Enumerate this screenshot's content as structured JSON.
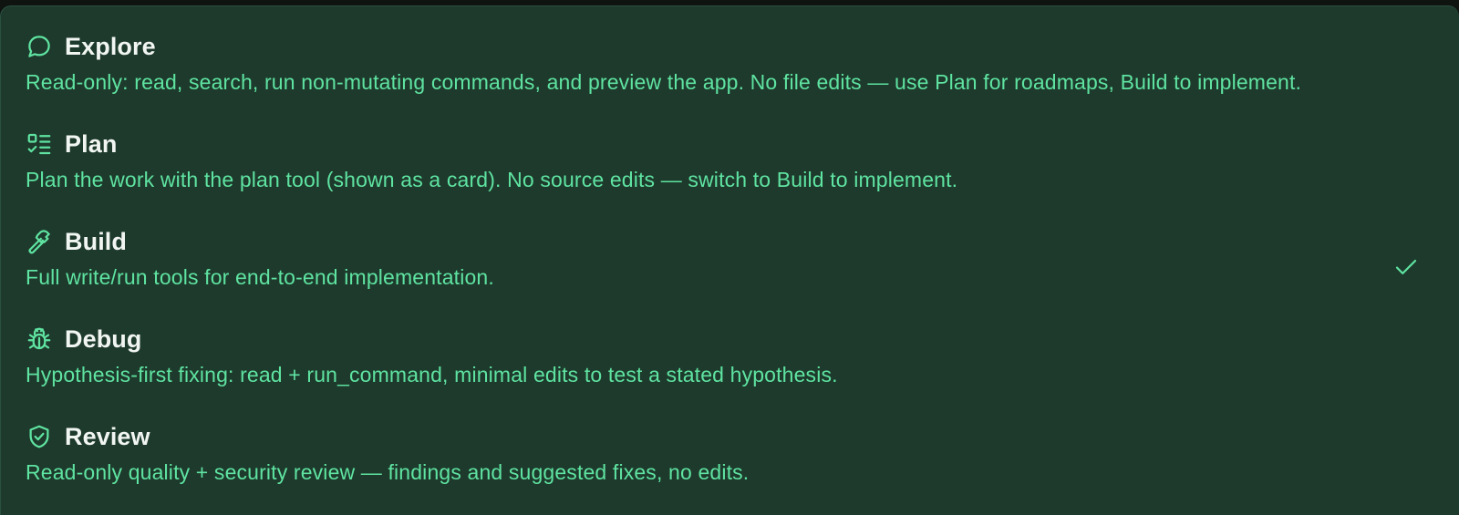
{
  "mode_menu": {
    "items": [
      {
        "icon": "chat-bubble-icon",
        "title": "Explore",
        "description": "Read-only: read, search, run non-mutating commands, and preview the app. No file edits — use Plan for roadmaps, Build to implement.",
        "selected": false
      },
      {
        "icon": "checklist-icon",
        "title": "Plan",
        "description": "Plan the work with the plan tool (shown as a card). No source edits — switch to Build to implement.",
        "selected": false
      },
      {
        "icon": "hammer-icon",
        "title": "Build",
        "description": "Full write/run tools for end-to-end implementation.",
        "selected": true
      },
      {
        "icon": "bug-icon",
        "title": "Debug",
        "description": "Hypothesis-first fixing: read + run_command, minimal edits to test a stated hypothesis.",
        "selected": false
      },
      {
        "icon": "shield-check-icon",
        "title": "Review",
        "description": "Read-only quality + security review — findings and suggested fixes, no edits.",
        "selected": false
      }
    ],
    "colors": {
      "background": "#1d3a2c",
      "title": "#f2f6f3",
      "description": "#5fe3a1",
      "icon": "#5fe3a1",
      "check": "#5fe3a1"
    }
  }
}
